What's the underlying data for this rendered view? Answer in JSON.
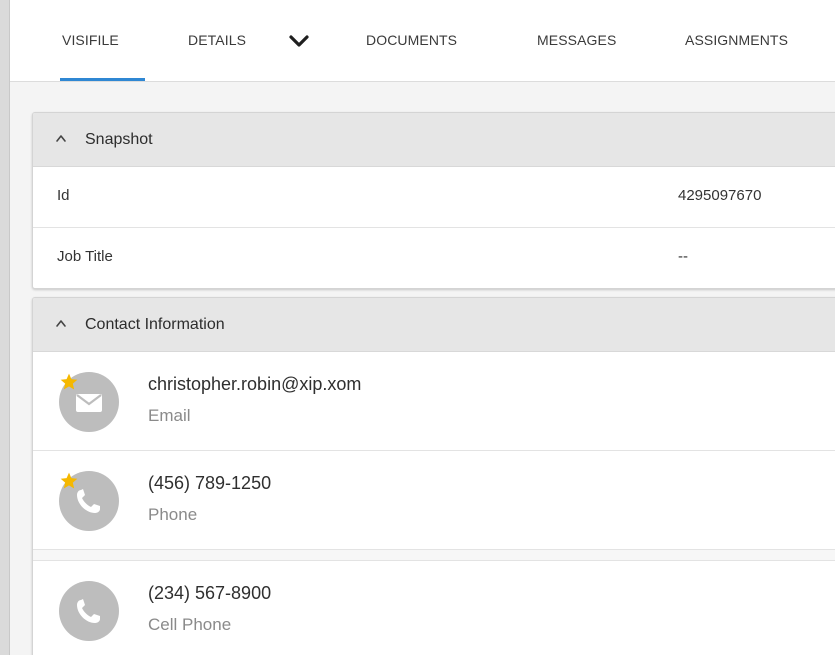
{
  "tabs": [
    {
      "label": "VISIFILE",
      "active": true
    },
    {
      "label": "DETAILS",
      "active": false,
      "has_dropdown": true
    },
    {
      "label": "DOCUMENTS",
      "active": false
    },
    {
      "label": "MESSAGES",
      "active": false
    },
    {
      "label": "ASSIGNMENTS",
      "active": false
    }
  ],
  "snapshot": {
    "title": "Snapshot",
    "rows": [
      {
        "label": "Id",
        "value": "4295097670"
      },
      {
        "label": "Job Title",
        "value": "--"
      }
    ]
  },
  "contact": {
    "title": "Contact Information",
    "items": [
      {
        "primary": "christopher.robin@xip.xom",
        "secondary": "Email",
        "icon": "email-icon",
        "starred": true
      },
      {
        "primary": "(456) 789-1250",
        "secondary": "Phone",
        "icon": "phone-icon",
        "starred": true
      },
      {
        "primary": "(234) 567-8900",
        "secondary": "Cell Phone",
        "icon": "phone-icon",
        "starred": false
      }
    ]
  },
  "colors": {
    "accent": "#2f87d3",
    "star": "#f5b800",
    "avatar": "#bdbdbd",
    "header_bg": "#e6e6e6"
  }
}
